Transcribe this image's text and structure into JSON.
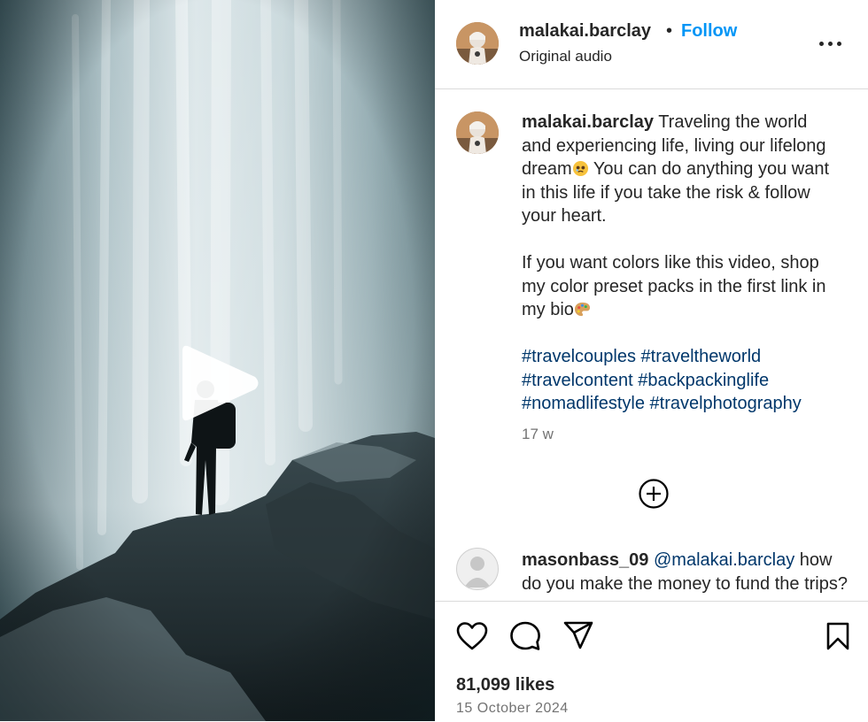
{
  "post": {
    "username": "malakai.barclay",
    "dot": "•",
    "follow_label": "Follow",
    "audio": "Original audio",
    "more_icon": "more-horizontal-icon",
    "caption": {
      "username": "malakai.barclay",
      "line1": "Traveling the world and experiencing life, living our lifelong dream",
      "line1_emoji": "holding-back-tears-emoji",
      "line1_rest": "You can do anything you want in this life if you take the risk & follow your heart.",
      "para2": "If you want colors like this video, shop my color preset packs in the first link in my bio",
      "para2_emoji": "artist-palette-emoji",
      "hashtags": [
        "#travelcouples",
        "#traveltheworld",
        "#travelcontent",
        "#backpackinglife",
        "#nomadlifestyle",
        "#travelphotography"
      ]
    },
    "age": "17 w",
    "load_more_icon": "plus-circle-icon",
    "comments": [
      {
        "username": "masonbass_09",
        "mention": "@malakai.barclay",
        "text": "how do you make the money to fund the trips?"
      }
    ],
    "actions": {
      "like_icon": "heart-icon",
      "comment_icon": "comment-icon",
      "share_icon": "send-icon",
      "save_icon": "bookmark-icon"
    },
    "likes": "81,099 likes",
    "date": "15 October 2024"
  },
  "media": {
    "type": "video",
    "play_icon": "play-icon"
  },
  "colors": {
    "link_blue": "#0095f6",
    "hashtag": "#00376b",
    "text": "#262626",
    "muted": "#737373",
    "divider": "#dbdbdb"
  }
}
